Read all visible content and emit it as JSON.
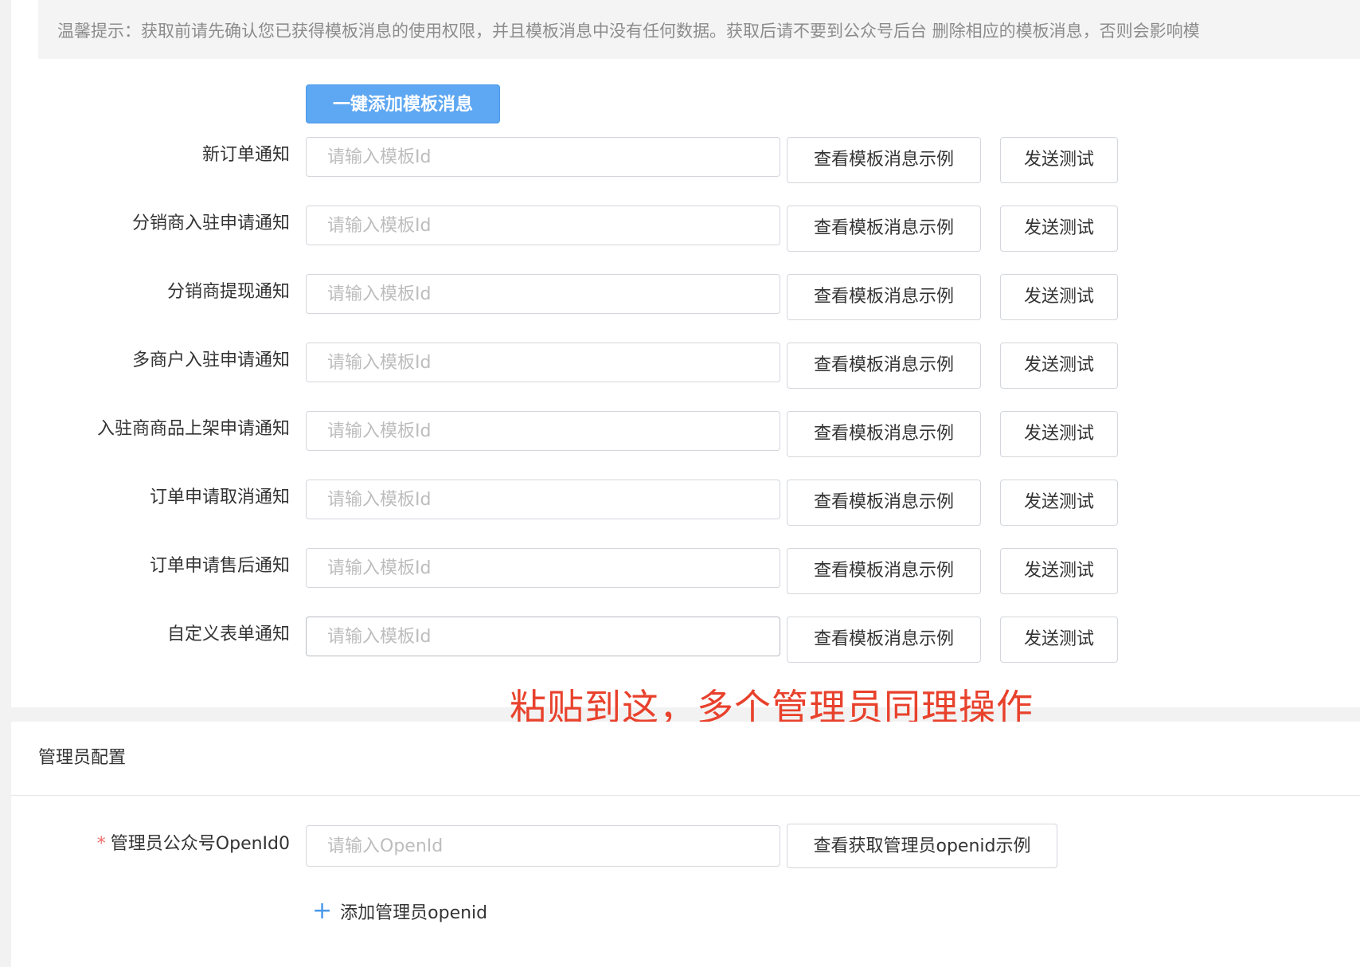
{
  "tip_text": "温馨提示：获取前请先确认您已获得模板消息的使用权限，并且模板消息中没有任何数据。获取后请不要到公众号后台 删除相应的模板消息，否则会影响模",
  "one_click_add_label": "一键添加模板消息",
  "input_placeholder": "请输入模板Id",
  "view_example_label": "查看模板消息示例",
  "send_test_label": "发送测试",
  "template_rows": [
    {
      "label": "新订单通知"
    },
    {
      "label": "分销商入驻申请通知"
    },
    {
      "label": "分销商提现通知"
    },
    {
      "label": "多商户入驻申请通知"
    },
    {
      "label": "入驻商商品上架申请通知"
    },
    {
      "label": "订单申请取消通知"
    },
    {
      "label": "订单申请售后通知"
    },
    {
      "label": "自定义表单通知"
    }
  ],
  "annotation_text": "粘贴到这，多个管理员同理操作",
  "annotation_color": "#e8412c",
  "admin_section": {
    "title": "管理员配置",
    "required_mark": "*",
    "openid_label": "管理员公众号OpenId0",
    "openid_placeholder": "请输入OpenId",
    "view_openid_example_label": "查看获取管理员openid示例",
    "add_admin_label": "添加管理员openid",
    "add_icon": "plus-icon"
  },
  "colors": {
    "primary": "#5ea7f2",
    "required": "#f56c6c",
    "link_icon": "#4a98ea"
  }
}
